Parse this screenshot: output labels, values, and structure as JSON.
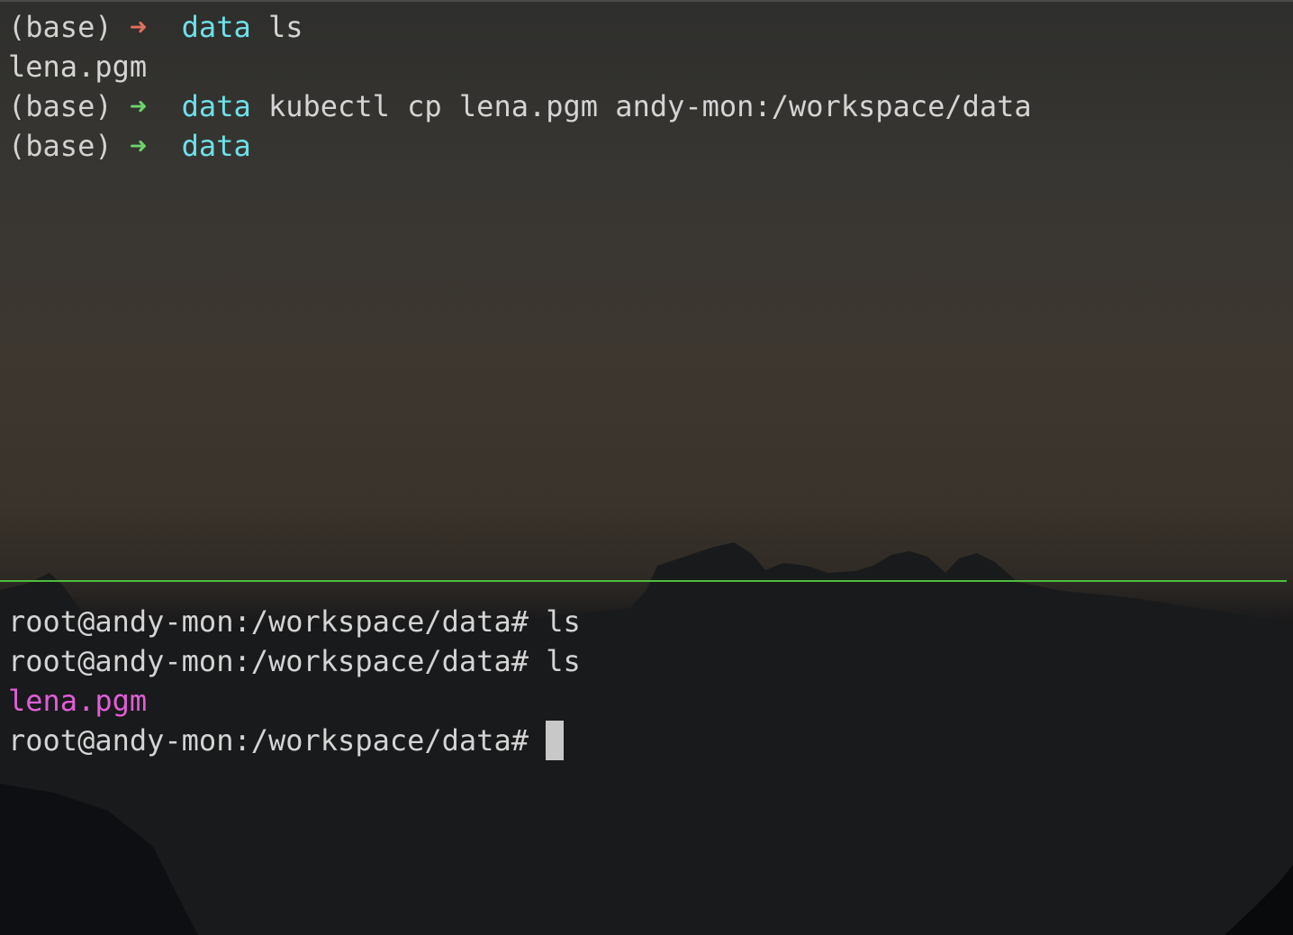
{
  "top_pane": {
    "lines": [
      {
        "env": "(base)",
        "arrow": "➜",
        "dir": "data",
        "cmd": "ls"
      },
      {
        "output": "lena.pgm"
      },
      {
        "env": "(base)",
        "arrow": "➜",
        "dir": "data",
        "cmd": "kubectl cp lena.pgm andy-mon:/workspace/data"
      },
      {
        "env": "(base)",
        "arrow": "➜",
        "dir": "data",
        "cmd": ""
      }
    ]
  },
  "bottom_pane": {
    "lines": [
      {
        "prompt": "root@andy-mon:/workspace/data#",
        "cmd": "ls"
      },
      {
        "prompt": "root@andy-mon:/workspace/data#",
        "cmd": "ls"
      },
      {
        "output": "lena.pgm"
      },
      {
        "prompt": "root@andy-mon:/workspace/data#",
        "cmd": ""
      }
    ]
  },
  "colors": {
    "arrow_error": "#e0705f",
    "arrow_ok": "#6cd36c",
    "directory": "#6ee0e8",
    "file_highlight": "#e05ed8",
    "divider": "#4cbf3a",
    "text": "#d4d4d4"
  }
}
